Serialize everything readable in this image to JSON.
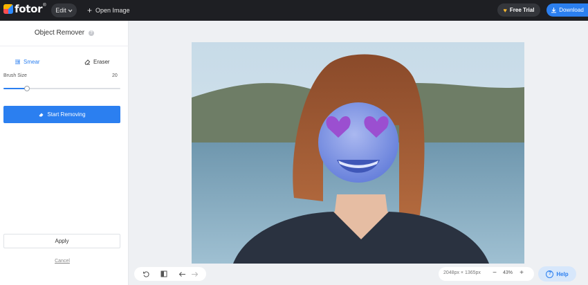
{
  "app": {
    "logo_text": "fotor",
    "logo_reg": "®"
  },
  "topbar": {
    "edit_label": "Edit",
    "open_image_label": "Open Image",
    "free_trial_label": "Free Trial",
    "download_label": "Download"
  },
  "sidebar": {
    "title": "Object Remover",
    "tabs": [
      {
        "label": "Smear",
        "active": true
      },
      {
        "label": "Eraser",
        "active": false
      }
    ],
    "brush_size_label": "Brush Size",
    "brush_size_value": "20",
    "brush_size_fraction": 0.2,
    "start_removing_label": "Start Removing",
    "apply_label": "Apply",
    "cancel_label": "Cancel"
  },
  "canvas": {
    "image_dimensions": "2048px × 1365px",
    "zoom": "43%"
  },
  "help": {
    "label": "Help"
  },
  "colors": {
    "accent": "#2b7ff0",
    "topbar": "#1e1f23",
    "heart": "#f5b731"
  },
  "icons": {
    "smear": "smear-brush-icon",
    "eraser": "eraser-icon",
    "start": "remove-icon",
    "reset": "reset-icon",
    "compare": "compare-icon",
    "undo": "undo-arrow-icon",
    "redo": "redo-arrow-icon",
    "download": "download-icon",
    "help": "help-circle-icon"
  }
}
